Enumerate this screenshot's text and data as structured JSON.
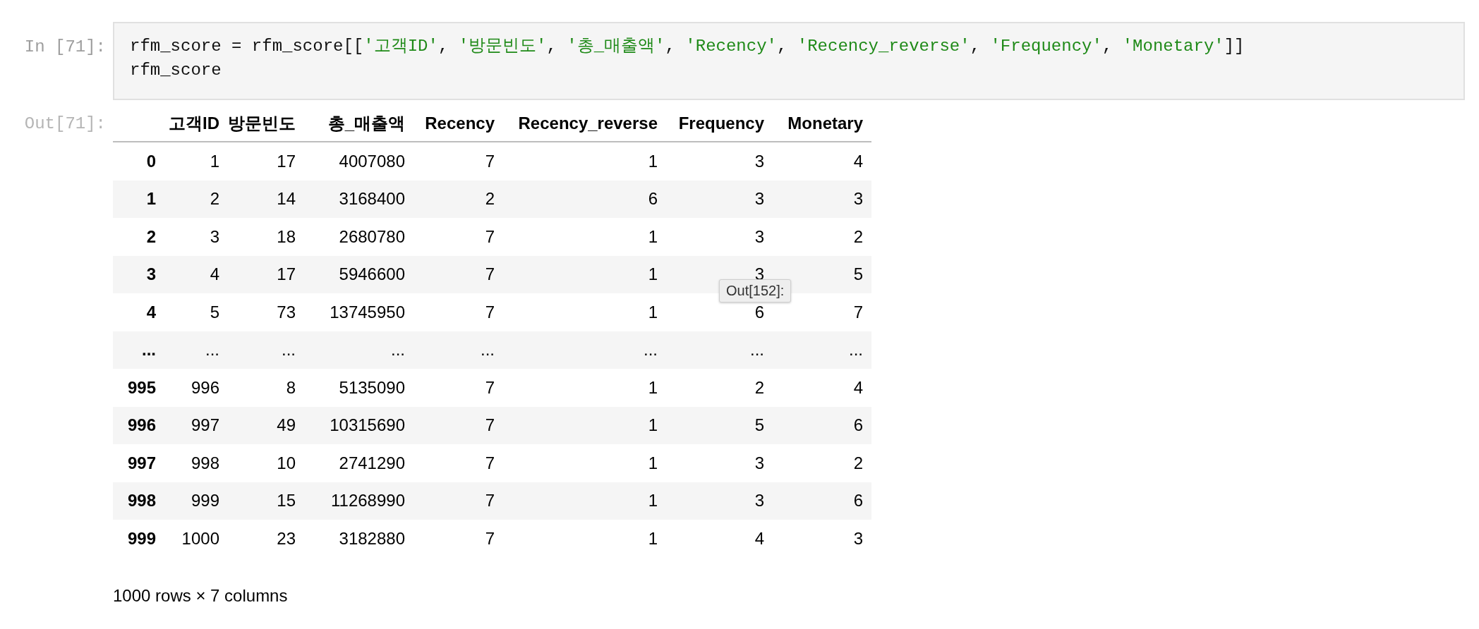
{
  "input_cell": {
    "prompt": "In [71]:",
    "code_lines": [
      [
        {
          "kind": "plain",
          "text": "rfm_score = rfm_score[["
        },
        {
          "kind": "string",
          "text": "'고객ID'"
        },
        {
          "kind": "plain",
          "text": ", "
        },
        {
          "kind": "string",
          "text": "'방문빈도'"
        },
        {
          "kind": "plain",
          "text": ", "
        },
        {
          "kind": "string",
          "text": "'총_매출액'"
        },
        {
          "kind": "plain",
          "text": ", "
        },
        {
          "kind": "string",
          "text": "'Recency'"
        },
        {
          "kind": "plain",
          "text": ", "
        },
        {
          "kind": "string",
          "text": "'Recency_reverse'"
        },
        {
          "kind": "plain",
          "text": ", "
        },
        {
          "kind": "string",
          "text": "'Frequency'"
        },
        {
          "kind": "plain",
          "text": ", "
        },
        {
          "kind": "string",
          "text": "'Monetary'"
        },
        {
          "kind": "plain",
          "text": "]]"
        }
      ],
      [
        {
          "kind": "plain",
          "text": "rfm_score"
        }
      ]
    ]
  },
  "output_cell": {
    "prompt": "Out[71]:",
    "table": {
      "columns": [
        "고객ID",
        "방문빈도",
        "총_매출액",
        "Recency",
        "Recency_reverse",
        "Frequency",
        "Monetary"
      ],
      "rows": [
        {
          "index": "0",
          "cells": [
            "1",
            "17",
            "4007080",
            "7",
            "1",
            "3",
            "4"
          ]
        },
        {
          "index": "1",
          "cells": [
            "2",
            "14",
            "3168400",
            "2",
            "6",
            "3",
            "3"
          ]
        },
        {
          "index": "2",
          "cells": [
            "3",
            "18",
            "2680780",
            "7",
            "1",
            "3",
            "2"
          ]
        },
        {
          "index": "3",
          "cells": [
            "4",
            "17",
            "5946600",
            "7",
            "1",
            "3",
            "5"
          ]
        },
        {
          "index": "4",
          "cells": [
            "5",
            "73",
            "13745950",
            "7",
            "1",
            "6",
            "7"
          ]
        },
        {
          "index": "...",
          "cells": [
            "...",
            "...",
            "...",
            "...",
            "...",
            "...",
            "..."
          ]
        },
        {
          "index": "995",
          "cells": [
            "996",
            "8",
            "5135090",
            "7",
            "1",
            "2",
            "4"
          ]
        },
        {
          "index": "996",
          "cells": [
            "997",
            "49",
            "10315690",
            "7",
            "1",
            "5",
            "6"
          ]
        },
        {
          "index": "997",
          "cells": [
            "998",
            "10",
            "2741290",
            "7",
            "1",
            "3",
            "2"
          ]
        },
        {
          "index": "998",
          "cells": [
            "999",
            "15",
            "11268990",
            "7",
            "1",
            "3",
            "6"
          ]
        },
        {
          "index": "999",
          "cells": [
            "1000",
            "23",
            "3182880",
            "7",
            "1",
            "4",
            "3"
          ]
        }
      ]
    },
    "summary": "1000 rows × 7 columns"
  },
  "tooltip": "Out[152]:"
}
